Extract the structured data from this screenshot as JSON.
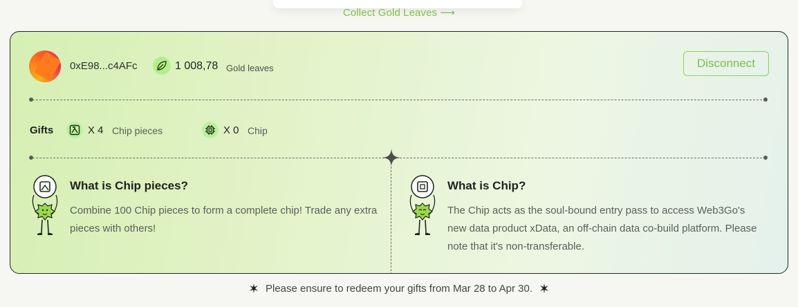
{
  "collect_link": "Collect Gold Leaves ⟶",
  "wallet": {
    "address": "0xE98...c4AFc",
    "leaf_amount": "1 008,78",
    "leaf_unit": "Gold leaves",
    "disconnect_label": "Disconnect"
  },
  "gifts": {
    "label": "Gifts",
    "items": [
      {
        "count": "X 4",
        "name": "Chip pieces",
        "icon": "chip-pieces-icon"
      },
      {
        "count": "X 0",
        "name": "Chip",
        "icon": "chip-icon"
      }
    ]
  },
  "info": [
    {
      "title": "What is Chip pieces?",
      "text": "Combine 100 Chip pieces to form a complete chip! Trade any extra pieces with others!"
    },
    {
      "title": "What is Chip?",
      "text": "The Chip acts as the soul-bound entry pass to access Web3Go's new data product xData, an off-chain data co-build platform. Please note that it's non-transferable."
    }
  ],
  "footer_note": "Please ensure to redeem your gifts from Mar 28 to Apr 30.",
  "colors": {
    "accent": "#7bc24a",
    "card_border": "#202820"
  }
}
